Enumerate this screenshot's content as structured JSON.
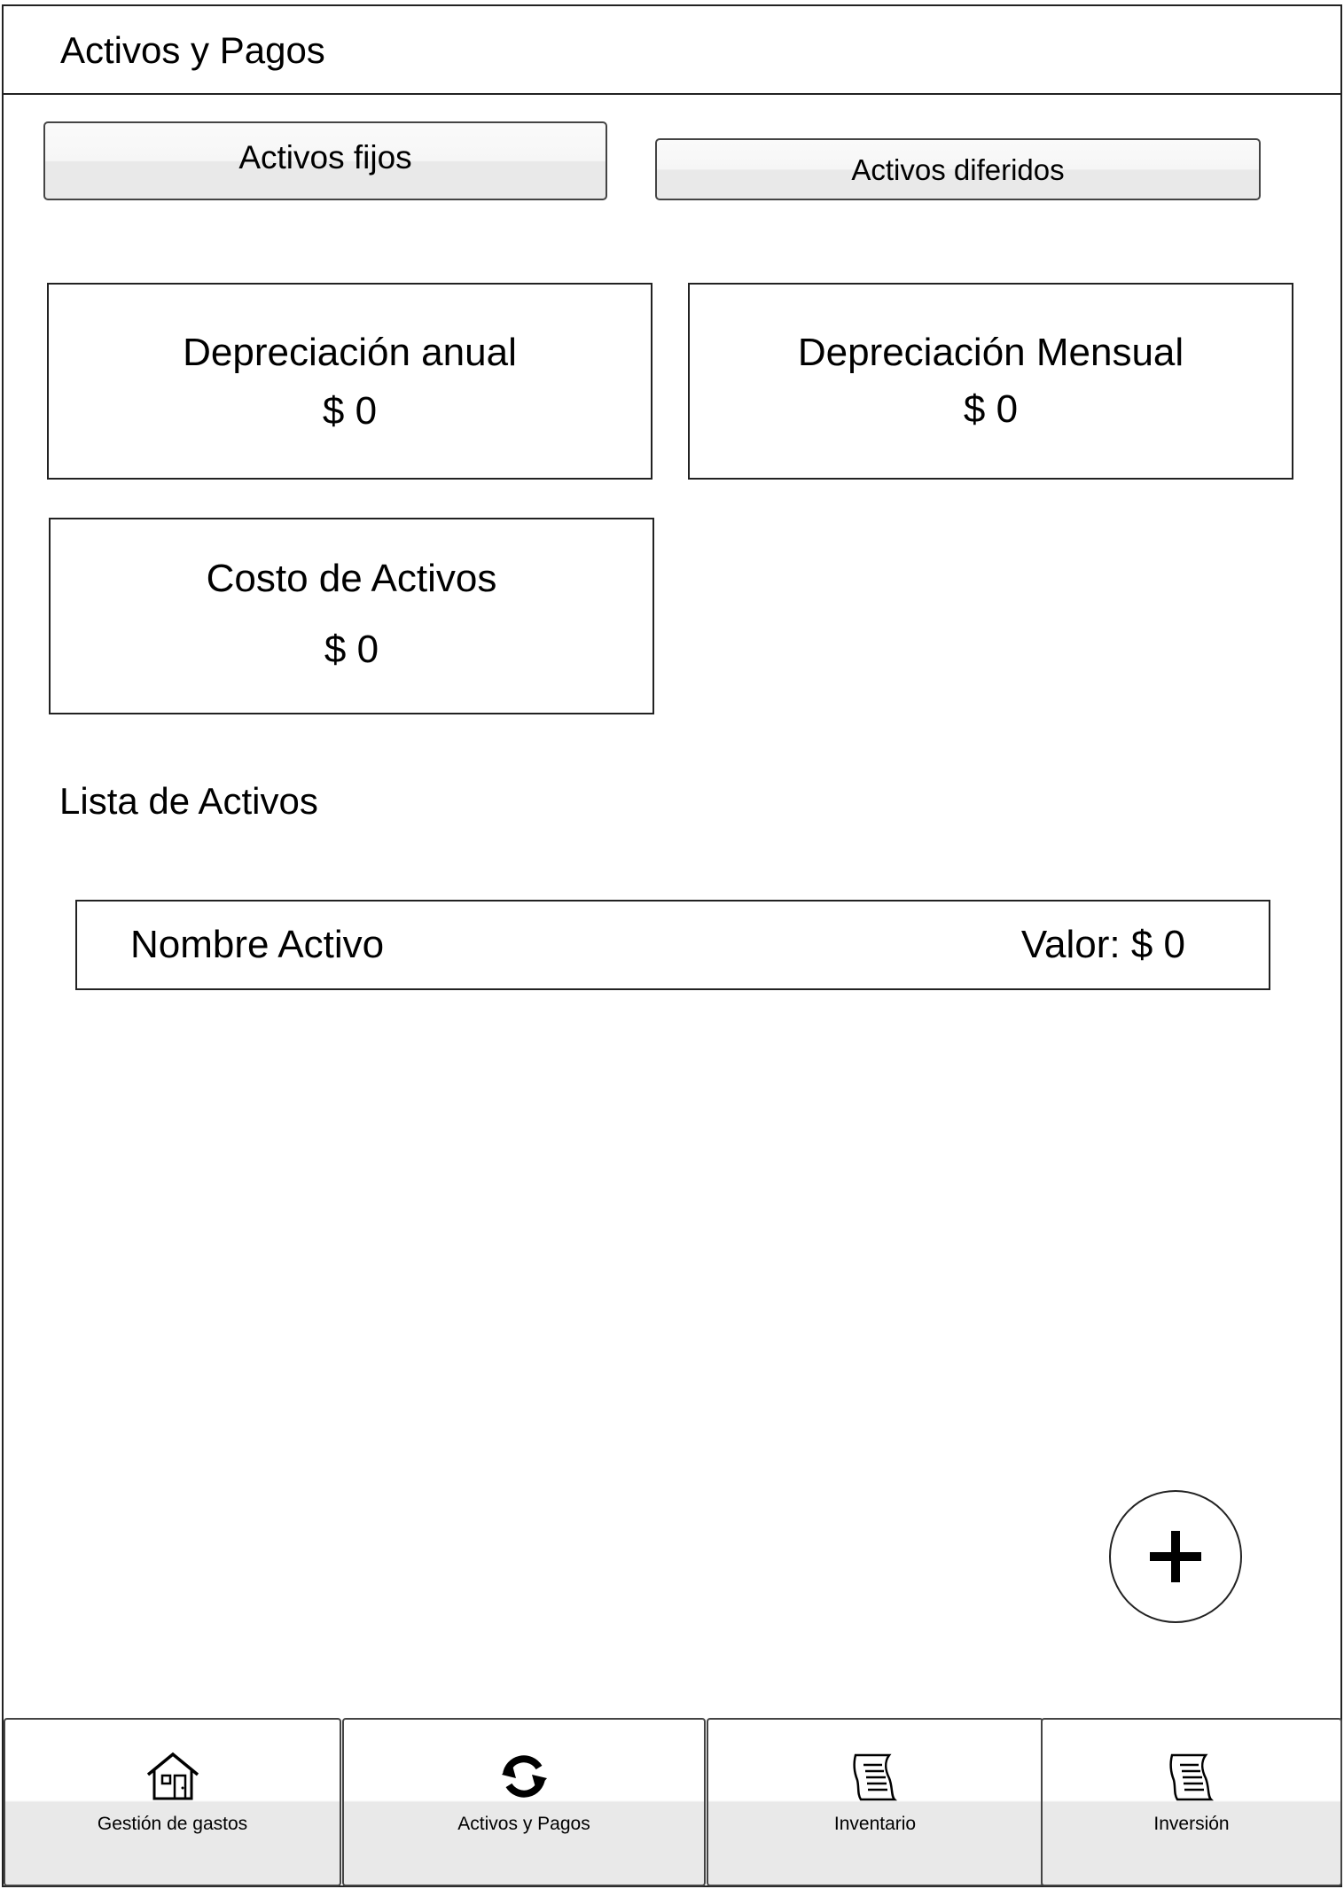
{
  "header": {
    "title": "Activos y Pagos"
  },
  "segments": {
    "fixed_label": "Activos fijos",
    "deferred_label": "Activos diferidos"
  },
  "cards": {
    "annual_depreciation": {
      "label": "Depreciación anual",
      "value": "$ 0"
    },
    "monthly_depreciation": {
      "label": "Depreciación Mensual",
      "value": "$ 0"
    },
    "asset_cost": {
      "label": "Costo de Activos",
      "value": "$ 0"
    }
  },
  "asset_list": {
    "title": "Lista de Activos",
    "items": [
      {
        "name": "Nombre Activo",
        "value": "Valor: $ 0"
      }
    ]
  },
  "fab": {
    "icon": "plus-icon"
  },
  "bottom_nav": {
    "tabs": [
      {
        "label": "Gestión de gastos",
        "icon": "house-icon"
      },
      {
        "label": "Activos y Pagos",
        "icon": "sync-arrows-icon"
      },
      {
        "label": "Inventario",
        "icon": "scroll-icon"
      },
      {
        "label": "Inversión",
        "icon": "scroll-icon"
      }
    ]
  }
}
